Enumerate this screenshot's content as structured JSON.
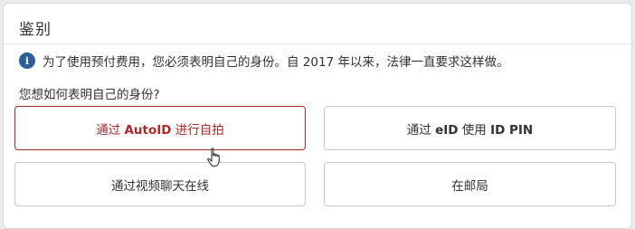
{
  "panel": {
    "title": "鉴别",
    "info_text": "为了使用预付费用，您必须表明自己的身份。自 2017 年以来，法律一直要求这样做。",
    "question": "您想如何表明自己的身份?"
  },
  "options": [
    {
      "prefix": "通过 ",
      "bold": "AutoID",
      "suffix": " 进行自拍",
      "selected": true
    },
    {
      "prefix": "通过 ",
      "bold": "eID",
      "suffix": " 使用 ",
      "bold2": "ID PIN",
      "selected": false
    },
    {
      "label": "通过视频聊天在线",
      "selected": false
    },
    {
      "label": "在邮局",
      "selected": false
    }
  ],
  "colors": {
    "accent": "#b02a2a",
    "info_icon": "#2d5f9a",
    "text": "#333333",
    "border": "#c9c9c9"
  },
  "icons": {
    "info": "info-icon",
    "cursor": "hand-pointer-cursor-icon"
  },
  "info_icon_glyph": "i"
}
